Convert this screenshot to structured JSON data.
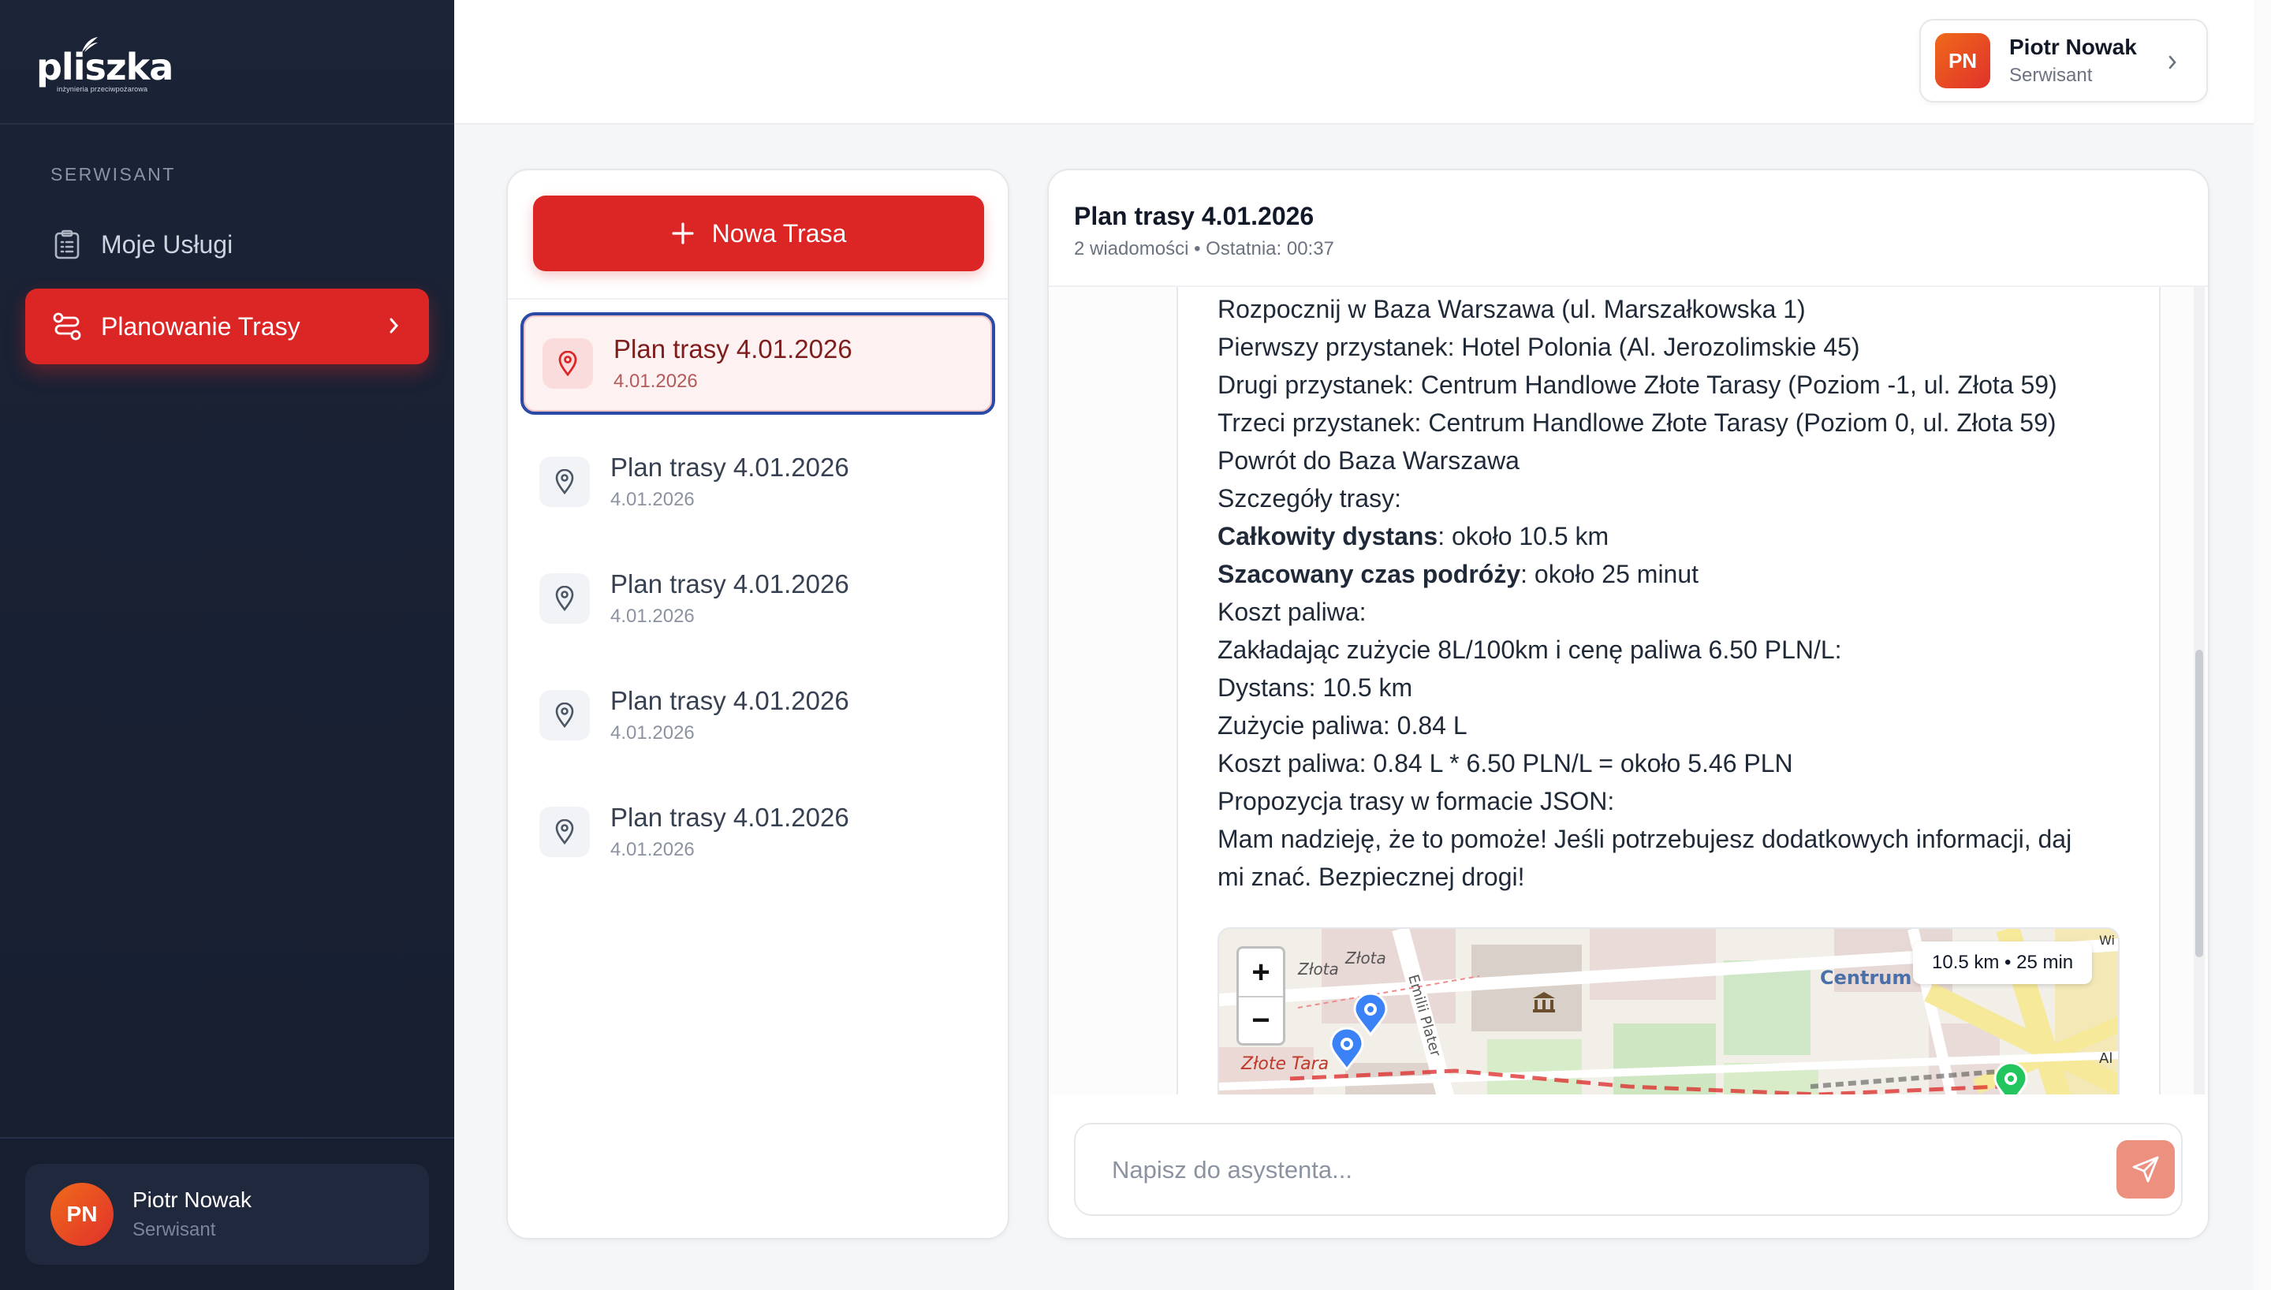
{
  "app": {
    "logo_text": "pliszka",
    "logo_tagline": "inżynieria przeciwpożarowa"
  },
  "sidebar": {
    "section_label": "SERWISANT",
    "items": [
      {
        "label": "Moje Usługi",
        "icon": "clipboard-icon",
        "active": false
      },
      {
        "label": "Planowanie Trasy",
        "icon": "route-icon",
        "active": true
      }
    ],
    "user": {
      "initials": "PN",
      "name": "Piotr Nowak",
      "role": "Serwisant"
    }
  },
  "header": {
    "user": {
      "initials": "PN",
      "name": "Piotr Nowak",
      "role": "Serwisant"
    }
  },
  "route_list": {
    "new_button_label": "Nowa Trasa",
    "items": [
      {
        "title": "Plan trasy 4.01.2026",
        "date": "4.01.2026",
        "active": true
      },
      {
        "title": "Plan trasy 4.01.2026",
        "date": "4.01.2026",
        "active": false
      },
      {
        "title": "Plan trasy 4.01.2026",
        "date": "4.01.2026",
        "active": false
      },
      {
        "title": "Plan trasy 4.01.2026",
        "date": "4.01.2026",
        "active": false
      },
      {
        "title": "Plan trasy 4.01.2026",
        "date": "4.01.2026",
        "active": false
      }
    ]
  },
  "chat": {
    "title": "Plan trasy 4.01.2026",
    "meta": "2 wiadomości • Ostatnia: 00:37",
    "message": {
      "lines": [
        {
          "text": "Rozpocznij w Baza Warszawa (ul. Marszałkowska 1)"
        },
        {
          "text": "Pierwszy przystanek: Hotel Polonia (Al. Jerozolimskie 45)"
        },
        {
          "text": "Drugi przystanek: Centrum Handlowe Złote Tarasy (Poziom -1, ul. Złota 59)"
        },
        {
          "text": "Trzeci przystanek: Centrum Handlowe Złote Tarasy (Poziom 0, ul. Złota 59)"
        },
        {
          "text": "Powrót do Baza Warszawa"
        },
        {
          "text": "Szczegóły trasy:"
        },
        {
          "bold": "Całkowity dystans",
          "text": ": około 10.5 km"
        },
        {
          "bold": "Szacowany czas podróży",
          "text": ": około 25 minut"
        },
        {
          "text": "Koszt paliwa:"
        },
        {
          "text": "Zakładając zużycie 8L/100km i cenę paliwa 6.50 PLN/L:"
        },
        {
          "text": "Dystans: 10.5 km"
        },
        {
          "text": "Zużycie paliwa: 0.84 L"
        },
        {
          "text": "Koszt paliwa: 0.84 L * 6.50 PLN/L = około 5.46 PLN"
        },
        {
          "text": "Propozycja trasy w formacie JSON:"
        },
        {
          "text": "Mam nadzieję, że to pomoże! Jeśli potrzebujesz dodatkowych informacji, daj"
        },
        {
          "text": "mi znać. Bezpiecznej drogi!"
        }
      ]
    },
    "map": {
      "badge": "10.5 km • 25 min",
      "zoom_in": "+",
      "zoom_out": "−",
      "labels": [
        "Złota",
        "Złota",
        "Emilii Plater",
        "Złote Tara",
        "Centrum",
        "Centrum",
        "Al",
        "Wi"
      ],
      "colors": {
        "marker_blue": "#3b82f6",
        "marker_green": "#22c55e",
        "route_red": "#dc2626"
      }
    },
    "input": {
      "placeholder": "Napisz do asystenta...",
      "value": ""
    }
  },
  "colors": {
    "accent": "#dc2626",
    "sidebar_bg": "#1b2336",
    "active_outline": "#2b4aa6"
  }
}
